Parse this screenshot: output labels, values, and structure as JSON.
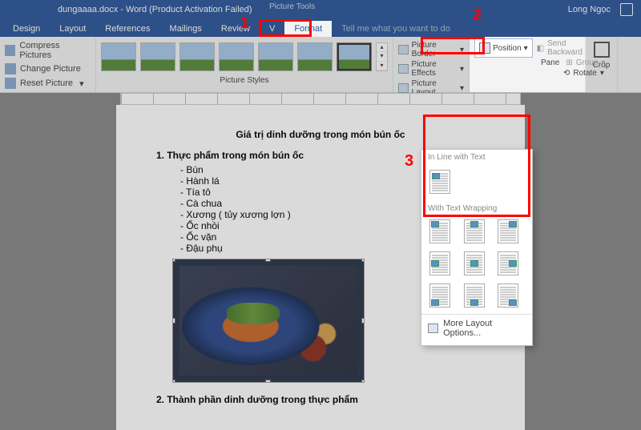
{
  "titlebar": {
    "filename": "dungaaaa.docx - Word (Product Activation Failed)",
    "picture_tools": "Picture Tools",
    "user": "Long Ngọc"
  },
  "tabs": {
    "design": "Design",
    "layout": "Layout",
    "references": "References",
    "mailings": "Mailings",
    "review": "Review",
    "view": "V",
    "format": "Format",
    "tellme": "Tell me what you want to do"
  },
  "ribbon": {
    "adjust": {
      "compress": "Compress Pictures",
      "change": "Change Picture",
      "reset": "Reset Picture"
    },
    "styles": {
      "label": "Picture Styles"
    },
    "picfmt": {
      "border": "Picture Border",
      "effects": "Picture Effects",
      "layout": "Picture Layout"
    },
    "arrange": {
      "position": "Position",
      "send_backward": "Send Backward",
      "pane": "Pane",
      "group": "Group",
      "rotate": "Rotate"
    },
    "crop": "Crop"
  },
  "pos_dropdown": {
    "inline_head": "In Line with Text",
    "wrap_head": "With Text Wrapping",
    "more": "More Layout Options..."
  },
  "doc": {
    "title": "Giá trị dinh dưỡng trong món bún ốc",
    "sec1": "1.   Thực phẩm trong món bún ốc",
    "items": [
      "- Bún",
      "- Hành lá",
      "- Tía tô",
      "- Cà chua",
      "- Xương ( tủy xương lợn )",
      "- Ốc nhồi",
      "- Ốc vặn",
      "- Đậu phụ"
    ],
    "sec2": "2.  Thành phần dinh dưỡng trong thực phẩm"
  },
  "annotations": {
    "n1": "1",
    "n2": "2",
    "n3": "3"
  }
}
